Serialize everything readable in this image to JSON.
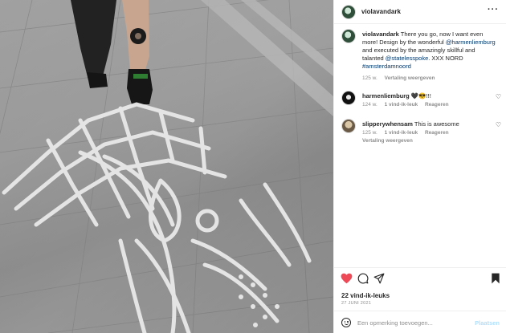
{
  "post": {
    "username": "violavandark",
    "more_icon": "more-horizontal-icon"
  },
  "caption": {
    "username": "violavandark",
    "text_1": " There you go, now I want even more! Design by the wonderful ",
    "mention_1": "@harmenliemburg",
    "text_2": " and executed by the amazingly skillful and talanted ",
    "mention_2": "@statelesspoke",
    "text_3": ". XXX NORD ",
    "hashtag": "#amsterdamnoord",
    "age": "125 w.",
    "translate": "Vertaling weergeven"
  },
  "comments": [
    {
      "username": "harmenliemburg",
      "text": " 🖤😎!!!",
      "age": "124 w.",
      "likes": "1 vind-ik-leuk",
      "reply": "Reageren"
    },
    {
      "username": "slipperywhensam",
      "text": " This is awesome",
      "age": "125 w.",
      "likes": "1 vind-ik-leuk",
      "reply": "Reageren",
      "translate": "Vertaling weergeven"
    }
  ],
  "actions": {
    "like_count": "22 vind-ik-leuks",
    "date": "27 JUNI 2021",
    "liked_color": "#ed4956"
  },
  "add_comment": {
    "placeholder": "Een opmerking toevoegen...",
    "post_label": "Plaatsen",
    "post_color": "#b2dffc"
  }
}
